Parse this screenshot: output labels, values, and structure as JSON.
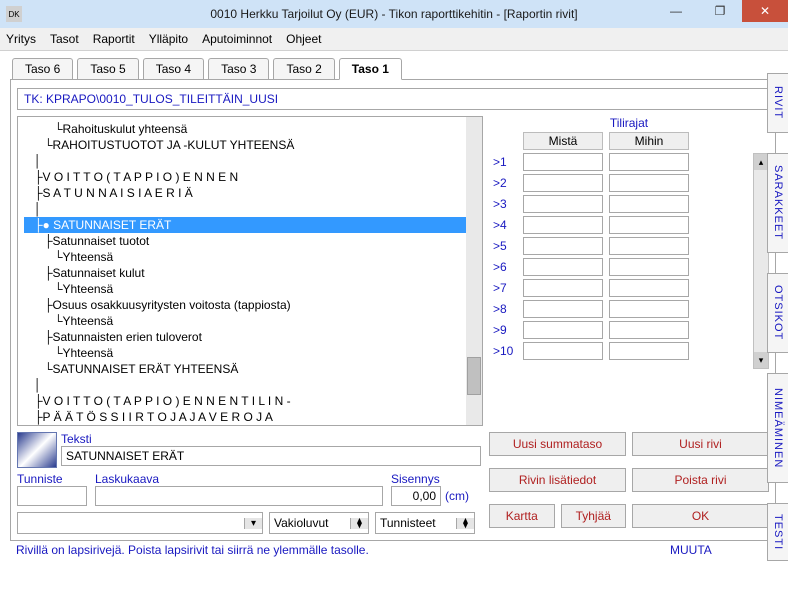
{
  "window": {
    "title": "0010  Herkku Tarjoilut Oy (EUR) - Tikon raporttikehitin - [Raportin rivit]",
    "minimize": "—",
    "restore": "❐",
    "close": "✕",
    "icon": "DK"
  },
  "menu": [
    "Yritys",
    "Tasot",
    "Raportit",
    "Ylläpito",
    "Aputoiminnot",
    "Ohjeet"
  ],
  "tabs": [
    "Taso 6",
    "Taso 5",
    "Taso 4",
    "Taso 3",
    "Taso 2",
    "Taso 1"
  ],
  "active_tab": "Taso 1",
  "header_path": "TK: KPRAPO\\0010_TULOS_TILEITTÄIN_UUSI",
  "tree": [
    {
      "indent": 3,
      "text": "Rahoituskulut yhteensä",
      "corner": true
    },
    {
      "indent": 2,
      "text": "RAHOITUSTUOTOT JA -KULUT YHTEENSÄ",
      "corner": true
    },
    {
      "indent": 1,
      "text": "",
      "corner": false
    },
    {
      "indent": 1,
      "text": "V O I T T O  ( T A P P I O )  E N N E N",
      "corner": false
    },
    {
      "indent": 1,
      "text": "S A T U N N A I S I A   E R I Ä",
      "corner": false
    },
    {
      "indent": 1,
      "text": "",
      "corner": false
    },
    {
      "indent": 1,
      "text": "SATUNNAISET ERÄT",
      "corner": false,
      "selected": true,
      "dot": true
    },
    {
      "indent": 2,
      "text": "Satunnaiset tuotot",
      "corner": false
    },
    {
      "indent": 3,
      "text": "Yhteensä",
      "corner": true
    },
    {
      "indent": 2,
      "text": "Satunnaiset kulut",
      "corner": false
    },
    {
      "indent": 3,
      "text": "Yhteensä",
      "corner": true
    },
    {
      "indent": 2,
      "text": "Osuus osakkuusyritysten voitosta (tappiosta)",
      "corner": false
    },
    {
      "indent": 3,
      "text": "Yhteensä",
      "corner": true
    },
    {
      "indent": 2,
      "text": "Satunnaisten erien tuloverot",
      "corner": false
    },
    {
      "indent": 3,
      "text": "Yhteensä",
      "corner": true
    },
    {
      "indent": 2,
      "text": "SATUNNAISET ERÄT YHTEENSÄ",
      "corner": true
    },
    {
      "indent": 1,
      "text": "",
      "corner": false
    },
    {
      "indent": 1,
      "text": "V O I T T O   ( T A P P I O )   E N N E N   T I L I N -",
      "corner": false
    },
    {
      "indent": 1,
      "text": "P Ä Ä T Ö S S I I R T O J A   J A   V E R O J A",
      "corner": false
    }
  ],
  "tilirajat": {
    "title": "Tilirajat",
    "col1": "Mistä",
    "col2": "Mihin",
    "rows": [
      ">1",
      ">2",
      ">3",
      ">4",
      ">5",
      ">6",
      ">7",
      ">8",
      ">9",
      ">10"
    ]
  },
  "form": {
    "teksti_label": "Teksti",
    "teksti_value": "SATUNNAISET ERÄT",
    "tunniste_label": "Tunniste",
    "tunniste_value": "",
    "laskukaava_label": "Laskukaava",
    "laskukaava_value": "",
    "sisennys_label": "Sisennys",
    "sisennys_value": "0,00",
    "sisennys_unit": "(cm)"
  },
  "combos": {
    "c1_placeholder": "",
    "c2": "Vakioluvut",
    "c3": "Tunnisteet"
  },
  "buttons": {
    "uusi_summa": "Uusi summataso",
    "uusi_rivi": "Uusi rivi",
    "lisatiedot": "Rivin lisätiedot",
    "poista": "Poista rivi",
    "kartta": "Kartta",
    "tyhjaa": "Tyhjää",
    "ok": "OK"
  },
  "verttabs": [
    "RIVIT",
    "SARAKKEET",
    "OTSIKOT",
    "NIMEÄMINEN",
    "TESTI"
  ],
  "status": {
    "left": "Rivillä on lapsirivejä. Poista lapsirivit tai siirrä ne ylemmälle tasolle.",
    "right": "MUUTA"
  }
}
